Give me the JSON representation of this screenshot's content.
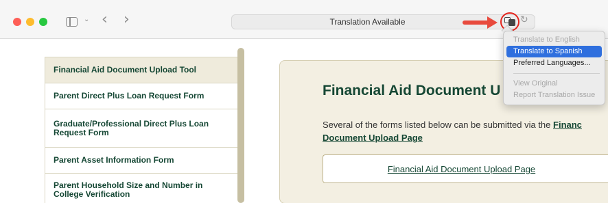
{
  "toolbar": {
    "address_text": "Translation Available",
    "icons": [
      "sidebar-toggle-icon",
      "chevron-down-icon",
      "back-icon",
      "forward-icon",
      "translate-icon",
      "reload-icon"
    ],
    "back_glyph": "‹",
    "forward_glyph": "›",
    "chevron_glyph": "⌄",
    "reload_glyph": "↻"
  },
  "translate_menu": {
    "items": [
      {
        "label": "Translate to English",
        "state": "disabled"
      },
      {
        "label": "Translate to Spanish",
        "state": "highlighted"
      },
      {
        "label": "Preferred Languages...",
        "state": "enabled"
      },
      {
        "label": "View Original",
        "state": "disabled"
      },
      {
        "label": "Report Translation Issue",
        "state": "disabled"
      }
    ]
  },
  "sidebar": {
    "items": [
      {
        "label": "Financial Aid Document Upload Tool",
        "active": true
      },
      {
        "label": "Parent Direct Plus Loan Request Form"
      },
      {
        "label": "Graduate/Professional Direct Plus Loan Request Form"
      },
      {
        "label": "Parent Asset Information Form"
      },
      {
        "label": "Parent Household Size and Number in College Verification"
      }
    ]
  },
  "main": {
    "title": "Financial Aid Document U",
    "description_prefix": "Several of the forms listed below can be submitted via the ",
    "description_link": "Financ",
    "description_link_cont": "Document Upload Page",
    "button_label": "Financial Aid Document Upload Page"
  },
  "colors": {
    "brand_green": "#154734",
    "card_background": "#f3efe2",
    "menu_highlight": "#2f6fde",
    "annotation_red": "#e3261e"
  }
}
